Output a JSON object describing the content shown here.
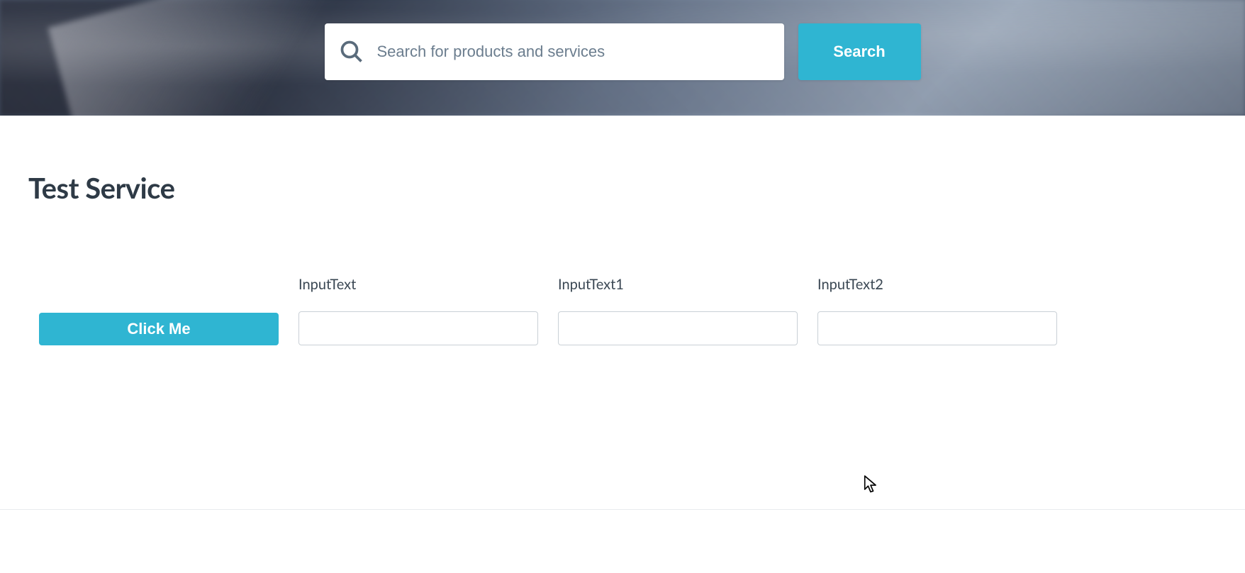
{
  "header": {
    "search_placeholder": "Search for products and services",
    "search_button_label": "Search"
  },
  "page": {
    "title": "Test Service"
  },
  "form": {
    "button_label": "Click Me",
    "fields": [
      {
        "label": "InputText",
        "value": ""
      },
      {
        "label": "InputText1",
        "value": ""
      },
      {
        "label": "InputText2",
        "value": ""
      }
    ]
  },
  "colors": {
    "accent": "#2fb5d2",
    "text_dark": "#2e3a46"
  }
}
